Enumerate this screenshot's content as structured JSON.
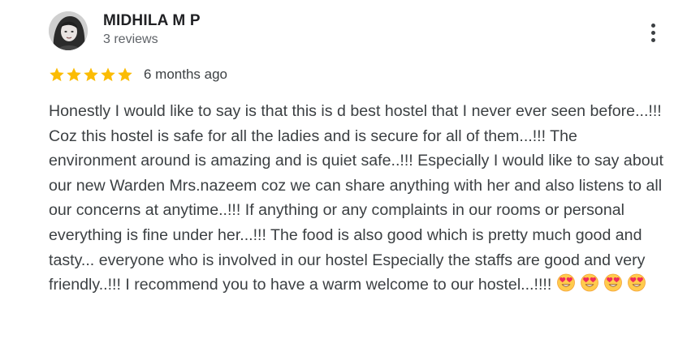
{
  "author": {
    "name": "MIDHILA M P",
    "review_count": "3 reviews",
    "avatar_icon": "profile-photo"
  },
  "review": {
    "rating": 5,
    "rating_max": 5,
    "star_color": "#fbbc04",
    "date": "6 months ago",
    "text": "Honestly I would like to say is that this is d best hostel that I never ever seen before...!!! Coz this hostel is safe for all the ladies and is secure for all of them...!!! The environment around is amazing and is quiet safe..!!! Especially I would like to say about our new Warden Mrs.nazeem coz we can share anything with her and also listens to all our concerns at anytime..!!! If anything or any complaints in our rooms or personal everything is fine under her...!!! The food is also good which is pretty much good and tasty... everyone who is involved in our hostel Especially the staffs are good and very friendly..!!! I recommend you to have a warm welcome to our hostel...!!!!",
    "emojis": [
      "smiling-face-with-heart-eyes",
      "smiling-face-with-heart-eyes",
      "smiling-face-with-heart-eyes",
      "smiling-face-with-heart-eyes"
    ]
  },
  "menu": {
    "icon": "more-vertical-icon"
  }
}
